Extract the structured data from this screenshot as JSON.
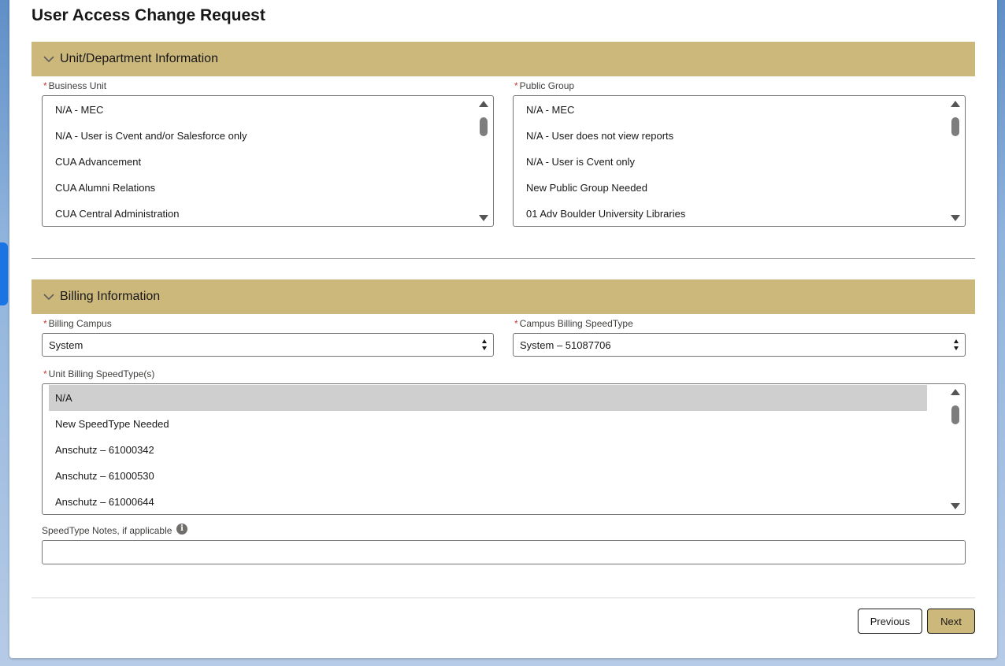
{
  "page": {
    "title": "User Access Change Request"
  },
  "sections": {
    "unit": {
      "title": "Unit/Department Information"
    },
    "billing": {
      "title": "Billing Information"
    }
  },
  "required_marker": "*",
  "business_unit": {
    "label": "Business Unit",
    "options": [
      "N/A - MEC",
      "N/A - User is Cvent and/or Salesforce only",
      "CUA Advancement",
      "CUA Alumni Relations",
      "CUA Central Administration"
    ]
  },
  "public_group": {
    "label": "Public Group",
    "options": [
      "N/A - MEC",
      "N/A - User does not view reports",
      "N/A - User is Cvent only",
      "New Public Group Needed",
      "01 Adv Boulder University Libraries"
    ]
  },
  "billing_campus": {
    "label": "Billing Campus",
    "value": "System"
  },
  "campus_speedtype": {
    "label": "Campus Billing SpeedType",
    "value": "System – 51087706"
  },
  "unit_speedtype": {
    "label": "Unit Billing SpeedType(s)",
    "options": [
      "N/A",
      "New SpeedType Needed",
      "Anschutz – 61000342",
      "Anschutz – 61000530",
      "Anschutz – 61000644"
    ],
    "selected": "N/A"
  },
  "speedtype_notes": {
    "label": "SpeedType Notes, if applicable",
    "value": "",
    "info_icon": "info-icon"
  },
  "buttons": {
    "previous": "Previous",
    "next": "Next"
  },
  "colors": {
    "section_header": "#cdb87c",
    "next_button": "#cdb87c",
    "required": "#c23934"
  }
}
